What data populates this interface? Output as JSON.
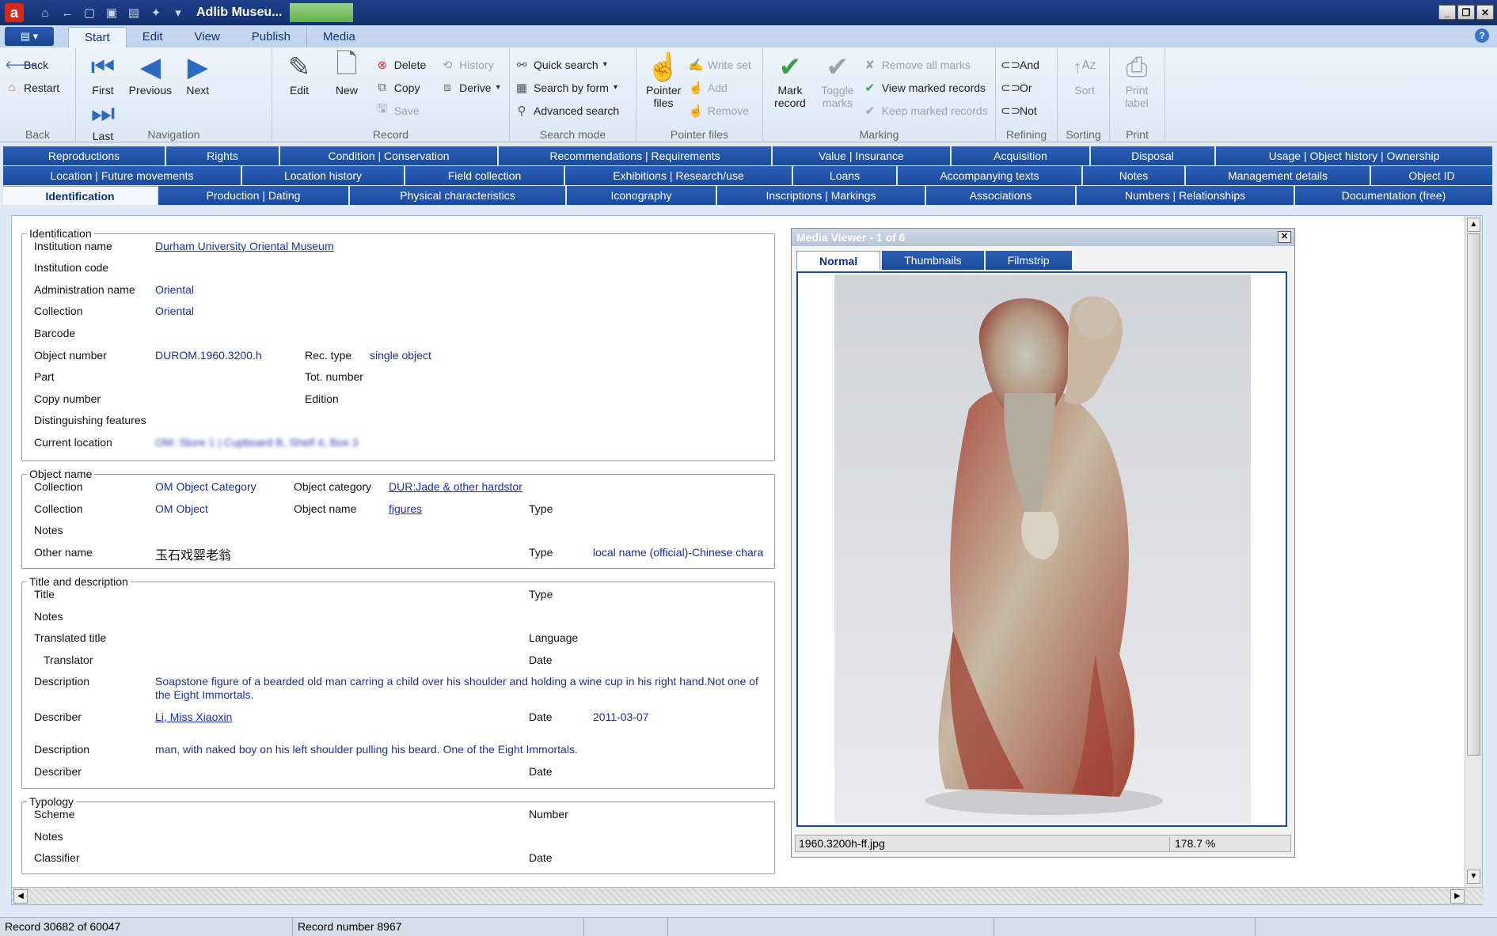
{
  "window": {
    "title": "Adlib Museu..."
  },
  "ribbon_tabs": [
    "Start",
    "Edit",
    "View",
    "Publish",
    "Media"
  ],
  "ribbon": {
    "back": {
      "back": "Back",
      "restart": "Restart",
      "label": "Back"
    },
    "navigation": {
      "first": "First",
      "previous": "Previous",
      "next": "Next",
      "last": "Last",
      "label": "Navigation"
    },
    "record": {
      "edit": "Edit",
      "new": "New",
      "delete": "Delete",
      "copy": "Copy",
      "save": "Save",
      "history": "History",
      "derive": "Derive",
      "label": "Record"
    },
    "search_mode": {
      "quick": "Quick search",
      "by_form": "Search by form",
      "advanced": "Advanced search",
      "label": "Search mode"
    },
    "pointer_files": {
      "pointer_files": "Pointer files",
      "write_set": "Write set",
      "add": "Add",
      "remove": "Remove",
      "label": "Pointer files"
    },
    "marking": {
      "mark_record": "Mark record",
      "toggle_marks": "Toggle marks",
      "remove_all": "Remove all marks",
      "view_marked": "View marked records",
      "keep_marked": "Keep marked records",
      "label": "Marking"
    },
    "refining": {
      "and": "And",
      "or": "Or",
      "not": "Not",
      "label": "Refining"
    },
    "sorting": {
      "sort": "Sort",
      "label": "Sorting"
    },
    "print": {
      "print_label": "Print label",
      "label": "Print"
    }
  },
  "form_tabs": {
    "row1": [
      "Reproductions",
      "Rights",
      "Condition | Conservation",
      "Recommendations | Requirements",
      "Value | Insurance",
      "Acquisition",
      "Disposal",
      "Usage | Object history | Ownership"
    ],
    "row2": [
      "Location | Future movements",
      "Location history",
      "Field collection",
      "Exhibitions | Research/use",
      "Loans",
      "Accompanying texts",
      "Notes",
      "Management details",
      "Object ID"
    ],
    "row3": [
      "Identification",
      "Production | Dating",
      "Physical characteristics",
      "Iconography",
      "Inscriptions | Markings",
      "Associations",
      "Numbers | Relationships",
      "Documentation (free)"
    ]
  },
  "identification": {
    "legend": "Identification",
    "institution_name_label": "Institution name",
    "institution_name": "Durham University Oriental Museum",
    "institution_code_label": "Institution code",
    "admin_name_label": "Administration name",
    "admin_name": "Oriental",
    "collection_label": "Collection",
    "collection": "Oriental",
    "barcode_label": "Barcode",
    "object_number_label": "Object number",
    "object_number": "DUROM.1960.3200.h",
    "rec_type_label": "Rec. type",
    "rec_type": "single object",
    "part_label": "Part",
    "tot_number_label": "Tot. number",
    "copy_number_label": "Copy number",
    "edition_label": "Edition",
    "distinguishing_label": "Distinguishing features",
    "current_location_label": "Current location",
    "current_location": "OM: Store 1 | Cupboard B, Shelf 4, Box 3"
  },
  "object_name": {
    "legend": "Object name",
    "collection_label": "Collection",
    "collection1": "OM Object Category",
    "object_category_label": "Object category",
    "object_category": "DUR:Jade & other hardstor",
    "collection2": "OM Object",
    "object_name_label": "Object name",
    "object_name": "figures",
    "type_label": "Type",
    "notes_label": "Notes",
    "other_name_label": "Other name",
    "other_name": "玉石戏婴老翁",
    "other_type": "local name (official)-Chinese chara"
  },
  "title_desc": {
    "legend": "Title and description",
    "title_label": "Title",
    "type_label": "Type",
    "notes_label": "Notes",
    "translated_title_label": "Translated title",
    "language_label": "Language",
    "translator_label": "Translator",
    "date_label": "Date",
    "description_label": "Description",
    "description1": "Soapstone figure of a bearded old man carring a child over his shoulder and holding a wine cup in his right hand.Not one of the Eight Immortals.",
    "describer_label": "Describer",
    "describer1": "Li, Miss Xiaoxin",
    "date1": "2011-03-07",
    "description2": "man, with naked boy on his left shoulder pulling his beard. One of the Eight Immortals."
  },
  "typology": {
    "legend": "Typology",
    "scheme_label": "Scheme",
    "number_label": "Number",
    "notes_label": "Notes",
    "classifier_label": "Classifier",
    "date_label": "Date"
  },
  "media_viewer": {
    "title": "Media Viewer - 1 of 6",
    "tabs": [
      "Normal",
      "Thumbnails",
      "Filmstrip"
    ],
    "filename": "1960.3200h-ff.jpg",
    "zoom": "178.7 %"
  },
  "status": {
    "record": "Record 30682 of 60047",
    "record_number": "Record number 8967"
  }
}
